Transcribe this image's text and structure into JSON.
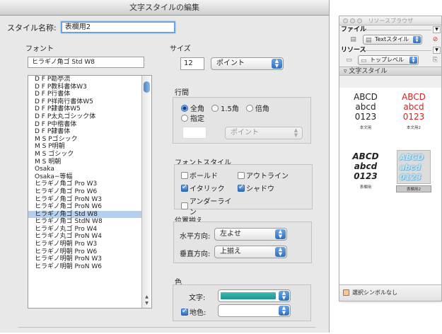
{
  "dialog": {
    "title": "文字スタイルの編集",
    "style_name_label": "スタイル名称:",
    "style_name_value": "表欄用2"
  },
  "font": {
    "label": "フォント",
    "current": "ヒラギノ角ゴ Std W8",
    "items": [
      "D F P勘亭流",
      "D F P教科書体W3",
      "D F P行書体",
      "D F P祥南行書体W5",
      "D F P隷書体W5",
      "D F P太丸ゴシック体",
      "D F P中楷書体",
      "D F P隷書体",
      "M S Pゴシック",
      "M S P明朝",
      "M S ゴシック",
      "M S 明朝",
      "Osaka",
      "Osaka−等幅",
      "ヒラギノ角ゴ Pro W3",
      "ヒラギノ角ゴ Pro W6",
      "ヒラギノ角ゴ ProN W3",
      "ヒラギノ角ゴ ProN W6",
      "ヒラギノ角ゴ Std W8",
      "ヒラギノ角ゴ StdN W8",
      "ヒラギノ丸ゴ Pro W4",
      "ヒラギノ丸ゴ ProN W4",
      "ヒラギノ明朝 Pro W3",
      "ヒラギノ明朝 Pro W6",
      "ヒラギノ明朝 ProN W3",
      "ヒラギノ明朝 ProN W6"
    ],
    "selected_index": 18
  },
  "size": {
    "label": "サイズ",
    "value": "12",
    "unit": "ポイント"
  },
  "leading": {
    "label": "行間",
    "opt_full": "全角",
    "opt_one_half": "1.5角",
    "opt_double": "倍角",
    "opt_custom": "指定",
    "selected": "全角",
    "unit": "ポイント"
  },
  "font_style": {
    "label": "フォントスタイル",
    "bold": "ボールド",
    "outline": "アウトライン",
    "italic": "イタリック",
    "shadow": "シャドウ",
    "underline": "アンダーライン",
    "italic_checked": true,
    "shadow_checked": true
  },
  "alignment": {
    "label": "位置揃え",
    "horizontal_label": "水平方向:",
    "horizontal_value": "左よせ",
    "vertical_label": "垂直方向:",
    "vertical_value": "上揃え"
  },
  "color": {
    "label": "色",
    "text_label": "文字:",
    "text_color": "#2aa7a1",
    "background_label": "地色:",
    "background_checked": true
  },
  "resource_browser": {
    "title": "リソースブラウザ",
    "file_label": "ファイル",
    "file_popup": "Textスタイル",
    "resource_label": "リソース",
    "resource_popup": "トップレベル",
    "list_header": "文字スタイル",
    "styles": [
      {
        "lines": [
          "ABCD",
          "abcd",
          "0123"
        ],
        "caption": "本文用"
      },
      {
        "lines": [
          "ABCD",
          "abcd",
          "0123"
        ],
        "caption": "本文用2"
      },
      {
        "lines": [
          "ABCD",
          "abcd",
          "0123"
        ],
        "caption": "表欄用"
      },
      {
        "lines": [
          "ABCD",
          "abcd",
          "0123"
        ],
        "caption": "表欄用2"
      }
    ],
    "footer": "選択シンボルなし"
  }
}
